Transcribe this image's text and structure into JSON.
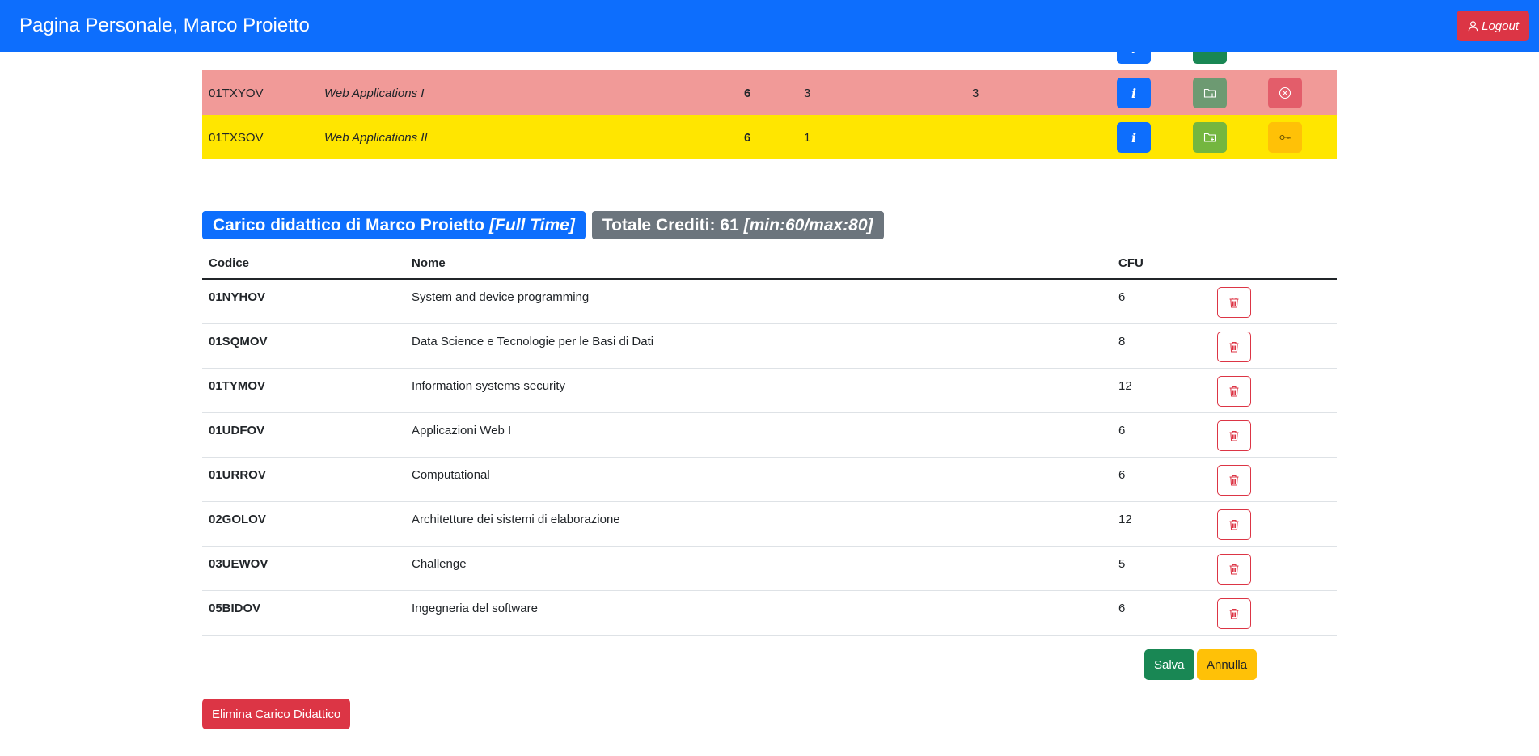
{
  "navbar": {
    "title": "Pagina Personale, Marco Proietto",
    "logout_label": "Logout"
  },
  "courses": [
    {
      "code": "01TXYOV",
      "name": "Web Applications I",
      "cfu": "6",
      "enrolled": "3",
      "max": "3",
      "state": "full"
    },
    {
      "code": "01TXSOV",
      "name": "Web Applications II",
      "cfu": "6",
      "enrolled": "1",
      "max": "",
      "state": "incompatible"
    }
  ],
  "plan": {
    "badge_title": "Carico didattico di Marco Proietto",
    "badge_type": "[Full Time]",
    "credits_label": "Totale Crediti: 61",
    "credits_range": "[min:60/max:80]",
    "headers": {
      "code": "Codice",
      "name": "Nome",
      "cfu": "CFU"
    },
    "rows": [
      {
        "code": "01NYHOV",
        "name": "System and device programming",
        "cfu": "6"
      },
      {
        "code": "01SQMOV",
        "name": "Data Science e Tecnologie per le Basi di Dati",
        "cfu": "8"
      },
      {
        "code": "01TYMOV",
        "name": "Information systems security",
        "cfu": "12"
      },
      {
        "code": "01UDFOV",
        "name": "Applicazioni Web I",
        "cfu": "6"
      },
      {
        "code": "01URROV",
        "name": "Computational",
        "cfu": "6"
      },
      {
        "code": "02GOLOV",
        "name": "Architetture dei sistemi di elaborazione",
        "cfu": "12"
      },
      {
        "code": "03UEWOV",
        "name": "Challenge",
        "cfu": "5"
      },
      {
        "code": "05BIDOV",
        "name": "Ingegneria del software",
        "cfu": "6"
      }
    ],
    "save_label": "Salva",
    "cancel_label": "Annulla",
    "delete_label": "Elimina Carico Didattico"
  },
  "icons": {
    "info": "info-icon",
    "add": "folder-plus-icon",
    "remove": "x-circle-icon",
    "locked": "key-icon",
    "trash": "trash-icon",
    "user": "person-icon"
  },
  "colors": {
    "primary": "#0d6efd",
    "danger": "#dc3545",
    "success": "#198754",
    "warning": "#ffc107",
    "row_full": "#f19a98",
    "row_incompatible": "#ffe600"
  }
}
